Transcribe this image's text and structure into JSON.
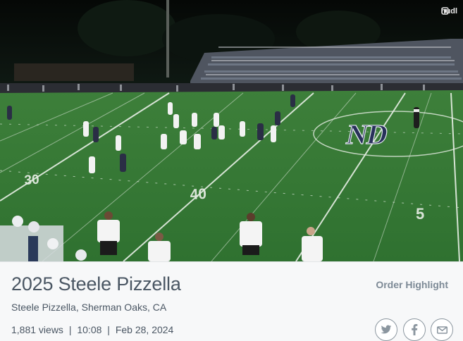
{
  "video": {
    "brand": "hudl",
    "yard_markers": [
      "30",
      "40",
      "5"
    ]
  },
  "highlight": {
    "title": "2025 Steele Pizzella",
    "subtitle": "Steele Pizzella, Sherman Oaks, CA",
    "views": "1,881 views",
    "duration": "10:08",
    "date": "Feb 28, 2024",
    "separator": "|",
    "order_label": "Order Highlight"
  },
  "share": [
    {
      "name": "twitter-icon"
    },
    {
      "name": "facebook-icon"
    },
    {
      "name": "email-icon"
    }
  ],
  "colors": {
    "field": "#3f8a3c",
    "text": "#4a5663",
    "accent_muted": "#7d8a96"
  }
}
